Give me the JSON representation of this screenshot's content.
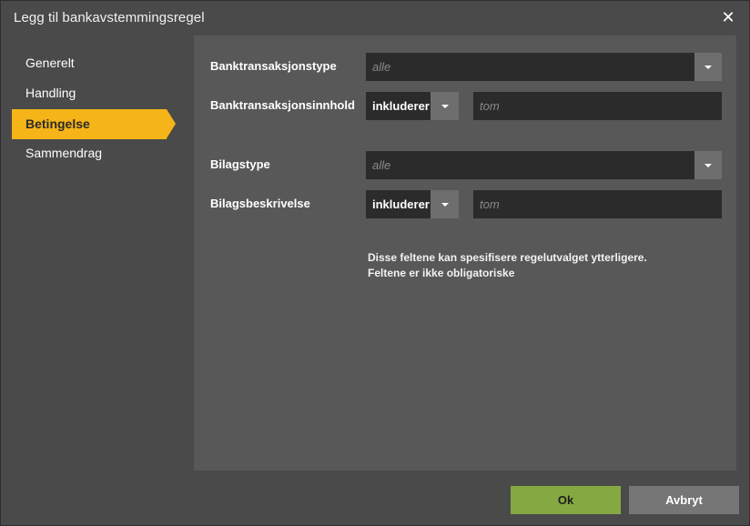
{
  "dialog": {
    "title": "Legg til bankavstemmingsregel",
    "close_glyph": "✕"
  },
  "sidebar": {
    "items": [
      {
        "label": "Generelt",
        "active": false
      },
      {
        "label": "Handling",
        "active": false
      },
      {
        "label": "Betingelse",
        "active": true
      },
      {
        "label": "Sammendrag",
        "active": false
      }
    ]
  },
  "form": {
    "bank_transaction_type": {
      "label": "Banktransaksjonstype",
      "value": "alle"
    },
    "bank_transaction_content": {
      "label": "Banktransaksjonsinnhold",
      "operator": "inkluderer",
      "placeholder": "tom"
    },
    "voucher_type": {
      "label": "Bilagstype",
      "value": "alle"
    },
    "voucher_description": {
      "label": "Bilagsbeskrivelse",
      "operator": "inkluderer",
      "placeholder": "tom"
    },
    "hint_line1": "Disse feltene kan spesifisere regelutvalget ytterligere.",
    "hint_line2": "Feltene er ikke obligatoriske"
  },
  "footer": {
    "ok_label": "Ok",
    "cancel_label": "Avbryt"
  },
  "colors": {
    "accent": "#f5b418",
    "ok": "#85a843",
    "panel": "#585858",
    "field": "#2b2b2b"
  },
  "icons": {
    "close": "close-icon",
    "dropdown": "chevron-down-icon"
  }
}
